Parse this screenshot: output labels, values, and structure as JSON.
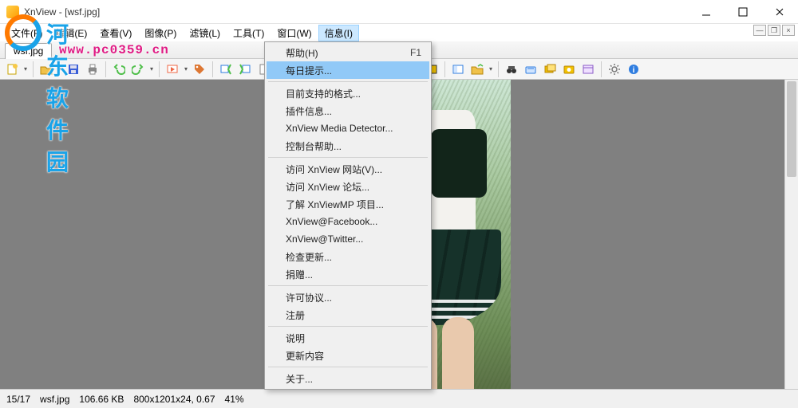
{
  "window": {
    "title": "XnView - [wsf.jpg]"
  },
  "watermark": {
    "text": "河东软件园",
    "url": "www.pc0359.cn"
  },
  "menu": {
    "items": [
      {
        "label": "文件(F)"
      },
      {
        "label": "编辑(E)"
      },
      {
        "label": "查看(V)"
      },
      {
        "label": "图像(P)"
      },
      {
        "label": "滤镜(L)"
      },
      {
        "label": "工具(T)"
      },
      {
        "label": "窗口(W)"
      },
      {
        "label": "信息(I)"
      }
    ]
  },
  "tabs": {
    "active": "wsf.jpg"
  },
  "dropdown": {
    "rows": [
      {
        "label": "帮助(H)",
        "shortcut": "F1"
      },
      {
        "label": "每日提示...",
        "highlight": true
      },
      {
        "sep": true
      },
      {
        "label": "目前支持的格式..."
      },
      {
        "label": "插件信息..."
      },
      {
        "label": "XnView Media Detector..."
      },
      {
        "label": "控制台帮助..."
      },
      {
        "sep": true
      },
      {
        "label": "访问 XnView 网站(V)..."
      },
      {
        "label": "访问 XnView 论坛..."
      },
      {
        "label": "了解 XnViewMP 项目..."
      },
      {
        "label": "XnView@Facebook..."
      },
      {
        "label": "XnView@Twitter..."
      },
      {
        "label": "检查更新..."
      },
      {
        "label": "捐赠..."
      },
      {
        "sep": true
      },
      {
        "label": "许可协议..."
      },
      {
        "label": "注册"
      },
      {
        "sep": true
      },
      {
        "label": "说明"
      },
      {
        "label": "更新内容"
      },
      {
        "sep": true
      },
      {
        "label": "关于..."
      }
    ]
  },
  "status": {
    "index": "15/17",
    "file": "wsf.jpg",
    "size": "106.66 KB",
    "dims": "800x1201x24, 0.67",
    "zoom": "41%"
  },
  "icons": {
    "c": {
      "new": "#f7c948",
      "open": "#f0b329",
      "save": "#3a5fd8",
      "print": "#6aa2ff",
      "undo": "#4fbf4a",
      "redo": "#4fbf4a",
      "cut": "#c54",
      "copy": "#d88c2b",
      "paste": "#d88c2b",
      "slideshow": "#e64",
      "fullscreen": "#2f7de0",
      "fit": "#fff",
      "zoomin": "#333",
      "zoomout": "#333",
      "rotl": "#2f7de0",
      "rotr": "#2f7de0",
      "browse": "#f0b329",
      "binoc": "#333",
      "scan": "#2f7de0",
      "batch": "#f2c200",
      "convert": "#f2c200",
      "web": "#8b5cc7",
      "gear": "#777",
      "info": "#2f7de0"
    }
  }
}
